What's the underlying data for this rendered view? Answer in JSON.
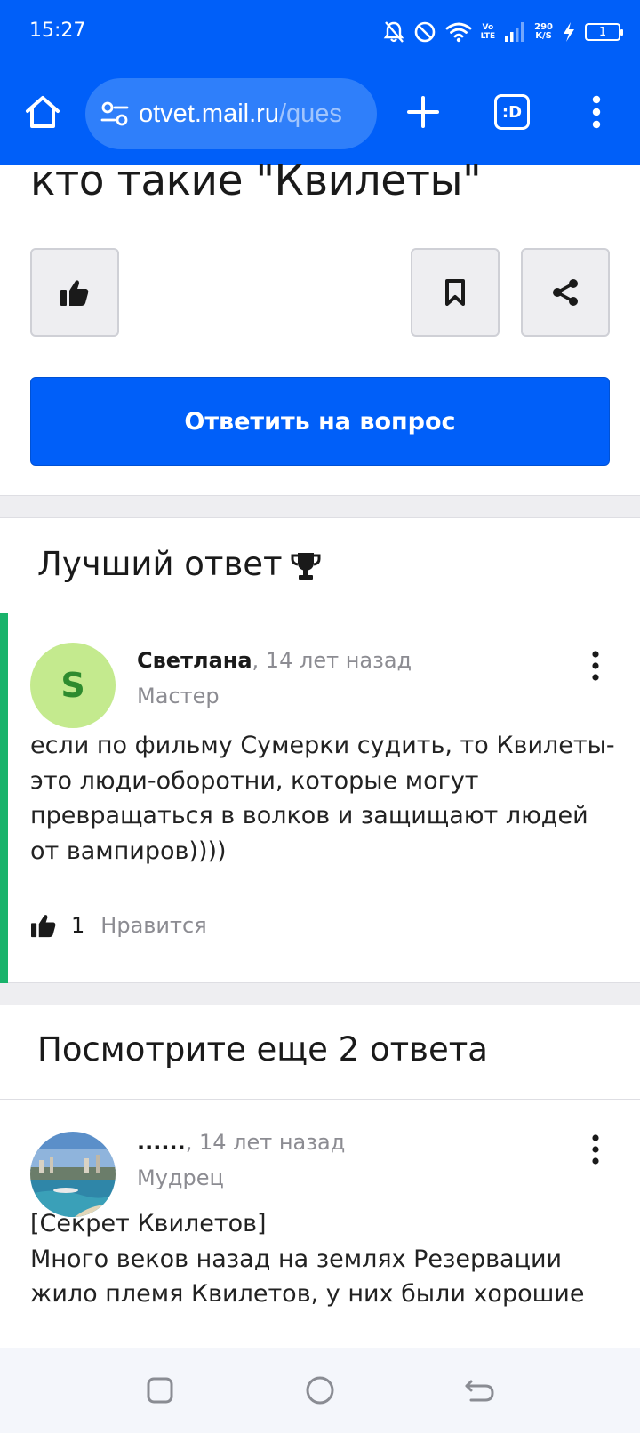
{
  "status": {
    "time": "15:27",
    "volte_top": "Vo",
    "volte_bottom": "LTE",
    "speed_value": "290",
    "speed_unit": "K/S",
    "battery": "1"
  },
  "browser": {
    "url_main": "otvet.mail.ru",
    "url_rest": "/ques",
    "tabs_label": ":D"
  },
  "question": {
    "title": "кто такие \"Квилеты\"",
    "answer_button": "Ответить на вопрос"
  },
  "best_answer": {
    "section_title": "Лучший ответ",
    "avatar_letter": "S",
    "author": "Светлана",
    "time": ", 14 лет назад",
    "rank": "Мастер",
    "text": "если по фильму Сумерки судить, то Квилеты-это люди-оборотни, которые могут превращаться в волков и защищают людей от вампиров))))",
    "likes": "1",
    "like_label": "Нравится"
  },
  "more_answers": {
    "section_title": "Посмотрите еще 2 ответа",
    "author": "......",
    "time": ", 14 лет назад",
    "rank": "Мудрец",
    "text_line1": "[Секрет Квилетов]",
    "text_line2": "Много веков назад на землях Резервации жило племя Квилетов, у них были хорошие"
  },
  "colors": {
    "brand_blue": "#005ff9",
    "best_accent": "#19b36b",
    "avatar_green": "#c4ea8e"
  },
  "icons": [
    "home-icon",
    "site-settings-icon",
    "plus-icon",
    "tabs-icon",
    "more-vert-icon",
    "thumbs-up-icon",
    "bookmark-icon",
    "share-icon",
    "trophy-icon",
    "square-nav-icon",
    "circle-nav-icon",
    "back-nav-icon"
  ]
}
